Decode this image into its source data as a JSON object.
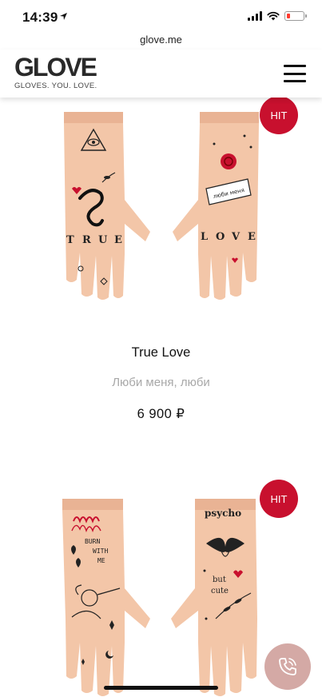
{
  "status": {
    "time": "14:39",
    "location_icon": "location-arrow-icon",
    "signal_icon": "cellular-signal-icon",
    "wifi_icon": "wifi-icon",
    "battery_icon": "battery-low-icon",
    "battery_color": "#ff3b30"
  },
  "browser": {
    "url": "glove.me"
  },
  "header": {
    "logo_word": "GLOVE",
    "logo_tagline": "GLOVES. YOU. LOVE.",
    "menu_icon": "hamburger-menu-icon"
  },
  "products": [
    {
      "badge": "HIT",
      "name": "True Love",
      "subtitle": "Люби меня, люби",
      "price": "6 900 ₽",
      "glove_text_left": "TRUE",
      "glove_text_right": "LOVE",
      "glove_banner": "люби меня люби"
    },
    {
      "badge": "HIT",
      "glove_text_left_1": "BURN",
      "glove_text_left_2": "WITH",
      "glove_text_left_3": "ME",
      "glove_text_right_top": "psycho",
      "glove_text_right_1": "but",
      "glove_text_right_2": "cute"
    }
  ],
  "colors": {
    "accent": "#c8102e",
    "glove_skin": "#f3c6a8",
    "glove_cuff": "#e9b394",
    "call_button": "#d4a9a5"
  },
  "call_button_icon": "phone-call-icon"
}
